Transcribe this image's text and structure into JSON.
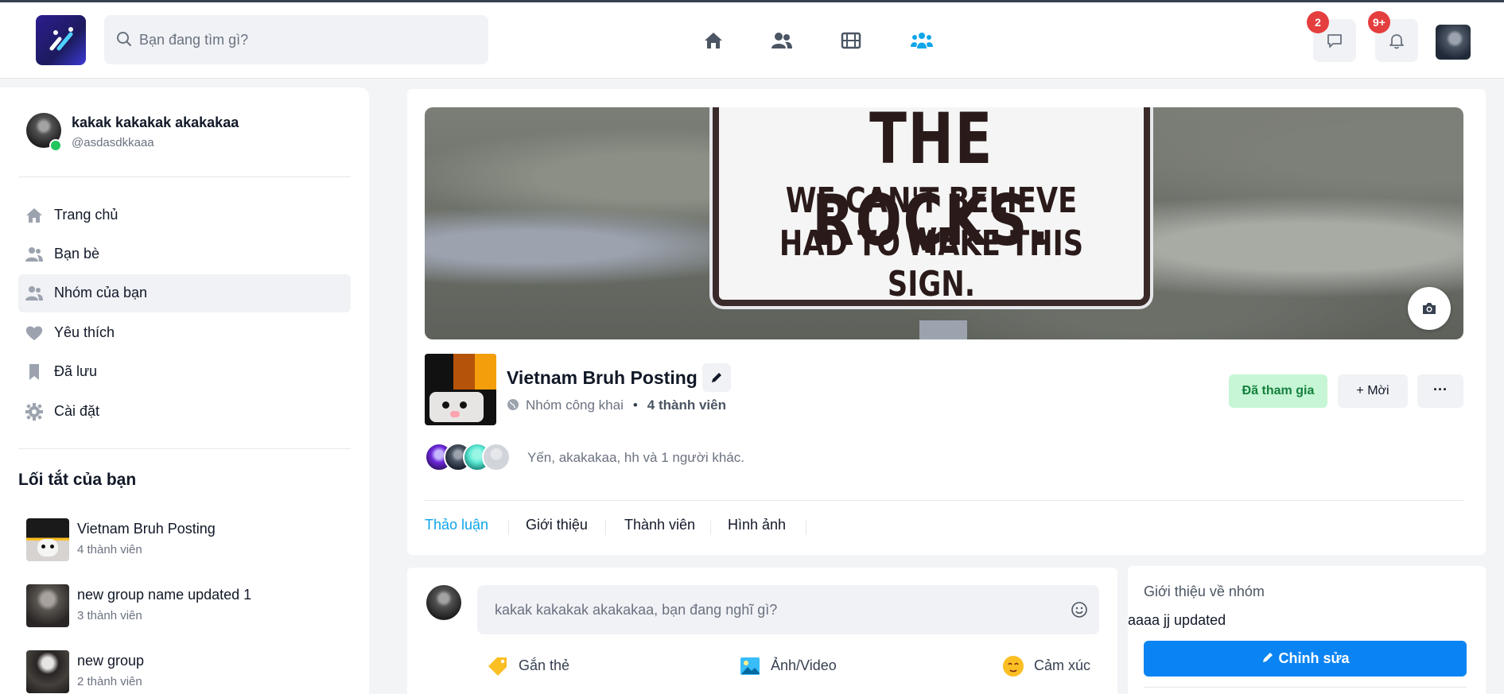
{
  "header": {
    "search_placeholder": "Bạn đang tìm gì?",
    "nav_icons": [
      "home-icon",
      "friends-icon",
      "video-icon",
      "groups-icon"
    ],
    "active_nav": "groups-icon",
    "messages_badge": "2",
    "notifications_badge": "9+",
    "accent_color": "#0ea5e9",
    "badge_color": "#e53e3e"
  },
  "sidebar": {
    "user": {
      "name": "kakak kakakak akakakaa",
      "handle": "@asdasdkkaaa",
      "online": true
    },
    "menu": [
      {
        "label": "Trang chủ",
        "icon": "home-icon"
      },
      {
        "label": "Bạn bè",
        "icon": "friends-icon"
      },
      {
        "label": "Nhóm của bạn",
        "icon": "groups-icon",
        "active": true
      },
      {
        "label": "Yêu thích",
        "icon": "heart-icon"
      },
      {
        "label": "Đã lưu",
        "icon": "bookmark-icon"
      },
      {
        "label": "Cài đặt",
        "icon": "gear-icon"
      }
    ],
    "shortcuts_title": "Lối tắt của bạn",
    "shortcuts": [
      {
        "name": "Vietnam Bruh Posting",
        "members": "4 thành viên"
      },
      {
        "name": "new group name updated 1",
        "members": "3 thành viên"
      },
      {
        "name": "new group",
        "members": "2 thành viên"
      }
    ]
  },
  "group": {
    "cover_sign": {
      "line1": "THE ROCKS.",
      "line2": "WE CAN'T BELIEVE WE",
      "line3": "HAD TO MAKE THIS SIGN."
    },
    "name": "Vietnam Bruh Posting",
    "privacy": "Nhóm công khai",
    "member_count": "4 thành viên",
    "joined_label": "Đã tham gia",
    "invite_label": "+ Mời",
    "more_label": "···",
    "members_text": "Yến, akakakaa, hh và 1 người khác.",
    "tabs": [
      "Thảo luận",
      "Giới thiệu",
      "Thành viên",
      "Hình ảnh"
    ],
    "active_tab": "Thảo luận"
  },
  "composer": {
    "placeholder": "kakak kakakak akakakaa, bạn đang nghĩ gì?",
    "actions": [
      {
        "label": "Gắn thẻ",
        "icon": "tag-icon"
      },
      {
        "label": "Ảnh/Video",
        "icon": "image-icon"
      },
      {
        "label": "Cảm xúc",
        "icon": "emoji-icon"
      }
    ]
  },
  "about": {
    "title": "Giới thiệu về nhóm",
    "description": "aaaa jj updated",
    "edit_label": "Chỉnh sửa"
  }
}
